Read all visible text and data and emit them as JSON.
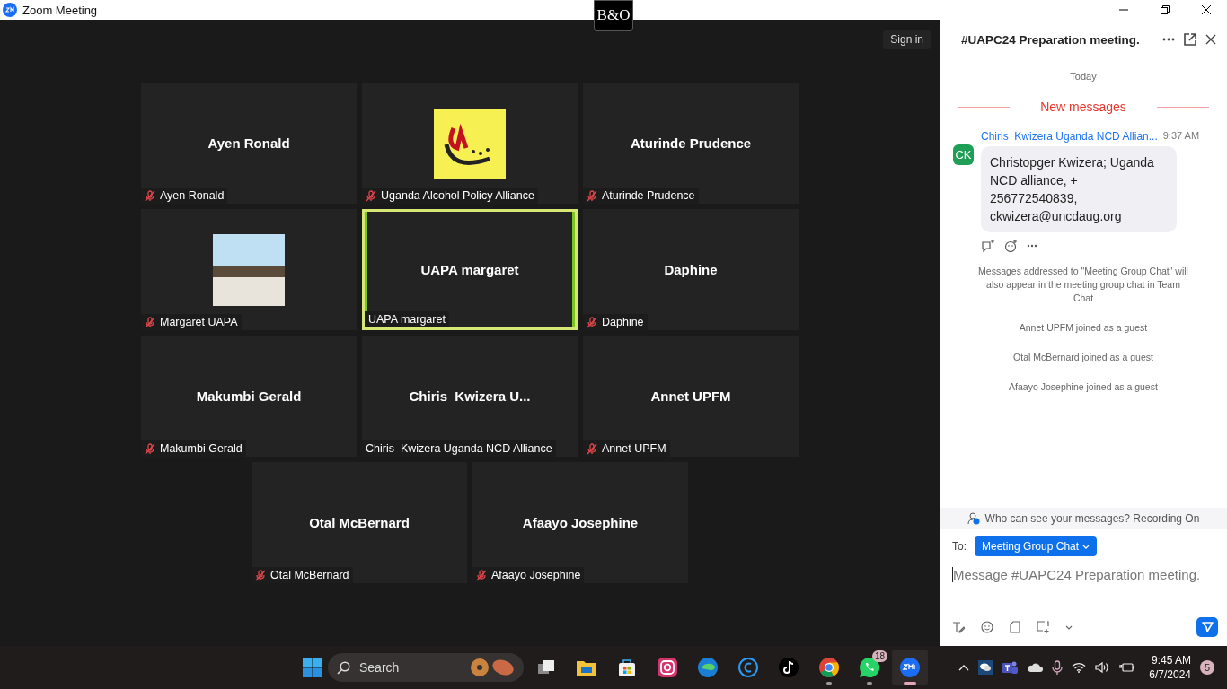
{
  "window": {
    "title": "Zoom Meeting",
    "badge": "B&O"
  },
  "meeting": {
    "sign_in": "Sign in",
    "tiles": [
      {
        "kind": "name",
        "name": "Ayen Ronald",
        "label": "Ayen Ronald",
        "muted": true,
        "speaking": false
      },
      {
        "kind": "logo",
        "label": "Uganda Alcohol Policy Alliance",
        "muted": true,
        "speaking": false
      },
      {
        "kind": "name",
        "name": "Aturinde Prudence",
        "label": "Aturinde Prudence",
        "muted": true,
        "speaking": false
      },
      {
        "kind": "photo",
        "label": "Margaret UAPA",
        "muted": true,
        "speaking": false
      },
      {
        "kind": "name",
        "name": "UAPA margaret",
        "label": "UAPA margaret",
        "muted": false,
        "speaking": true
      },
      {
        "kind": "name",
        "name": "Daphine",
        "label": "Daphine",
        "muted": true,
        "speaking": false
      },
      {
        "kind": "name",
        "name": "Makumbi Gerald",
        "label": "Makumbi Gerald",
        "muted": true,
        "speaking": false
      },
      {
        "kind": "name",
        "name": "Chiris  Kwizera U...",
        "label": "Chiris  Kwizera Uganda NCD Alliance",
        "muted": false,
        "speaking": false
      },
      {
        "kind": "name",
        "name": "Annet UPFM",
        "label": "Annet UPFM",
        "muted": true,
        "speaking": false
      },
      {
        "kind": "name",
        "name": "Otal McBernard",
        "label": "Otal McBernard",
        "muted": true,
        "speaking": false
      },
      {
        "kind": "name",
        "name": "Afaayo Josephine",
        "label": "Afaayo Josephine",
        "muted": true,
        "speaking": false
      }
    ]
  },
  "chat": {
    "title": "#UAPC24 Preparation meeting.",
    "date": "Today",
    "new_divider": "New messages",
    "messages": [
      {
        "sender": "Chiris  Kwizera Uganda NCD Allian...",
        "time": "9:37 AM",
        "initials": "CK",
        "text": "Christopger Kwizera; Uganda NCD alliance, + 256772540839, ckwizera@uncdaug.org"
      }
    ],
    "notices": [
      "Messages addressed to \"Meeting Group Chat\" will also appear in the meeting group chat in Team Chat",
      "Annet UPFM joined as a guest",
      "Otal McBernard joined as a guest",
      "Afaayo Josephine joined as a guest"
    ],
    "privacy": "Who can see your messages? Recording On",
    "to_label": "To:",
    "recipient": "Meeting Group Chat",
    "placeholder": "Message #UAPC24 Preparation meeting."
  },
  "taskbar": {
    "search": {
      "placeholder": "Search"
    },
    "apps": [
      {
        "kind": "taskview",
        "running": false,
        "selected": false
      },
      {
        "kind": "folder",
        "running": false,
        "selected": false
      },
      {
        "kind": "store",
        "running": false,
        "selected": false
      },
      {
        "kind": "instagram",
        "running": false,
        "selected": false
      },
      {
        "kind": "edge",
        "running": false,
        "selected": false
      },
      {
        "kind": "ccircle",
        "running": false,
        "selected": false
      },
      {
        "kind": "tiktok",
        "running": false,
        "selected": false
      },
      {
        "kind": "chrome",
        "running": true,
        "selected": false
      },
      {
        "kind": "whatsapp",
        "running": true,
        "selected": false,
        "badge": "18"
      },
      {
        "kind": "zoom",
        "running": true,
        "selected": true
      }
    ],
    "clock": {
      "time": "9:45 AM",
      "date": "6/7/2024"
    },
    "notifications": "5"
  }
}
